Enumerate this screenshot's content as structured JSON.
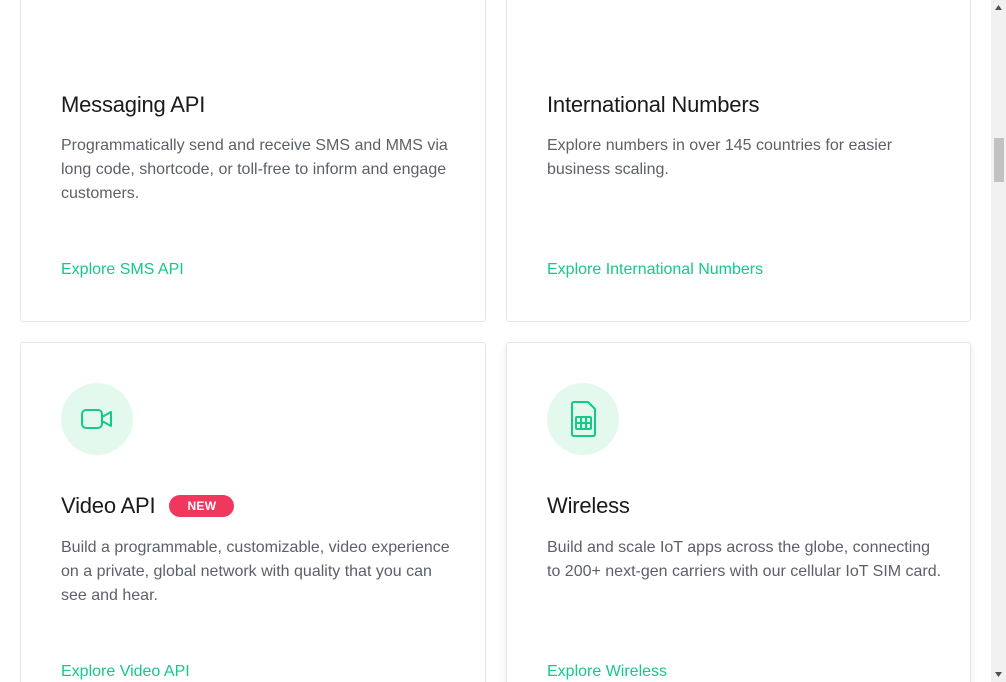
{
  "colors": {
    "accent": "#14c98a",
    "icon_bg": "#e3f9ee",
    "badge": "#f2375f",
    "title": "#1a1a1a",
    "text": "#5c6168"
  },
  "cards": [
    {
      "title": "Messaging API",
      "description": "Programmatically send and receive SMS and MMS via long code, shortcode, or toll-free to inform and engage customers.",
      "link": "Explore SMS API"
    },
    {
      "title": "International Numbers",
      "description": "Explore numbers in over 145 countries for easier business scaling.",
      "link": "Explore International Numbers"
    },
    {
      "icon": "video-camera-icon",
      "title": "Video API",
      "badge": "NEW",
      "description": "Build a programmable, customizable, video experience on a private, global network with quality that you can see and hear.",
      "link": "Explore Video API"
    },
    {
      "icon": "sim-card-icon",
      "title": "Wireless",
      "description": "Build and scale IoT apps across the globe, connecting to 200+ next-gen carriers with our cellular IoT SIM card.",
      "link": "Explore Wireless"
    }
  ],
  "scrollbar": {
    "up_icon": "arrow-up-icon",
    "down_icon": "arrow-down-icon"
  }
}
